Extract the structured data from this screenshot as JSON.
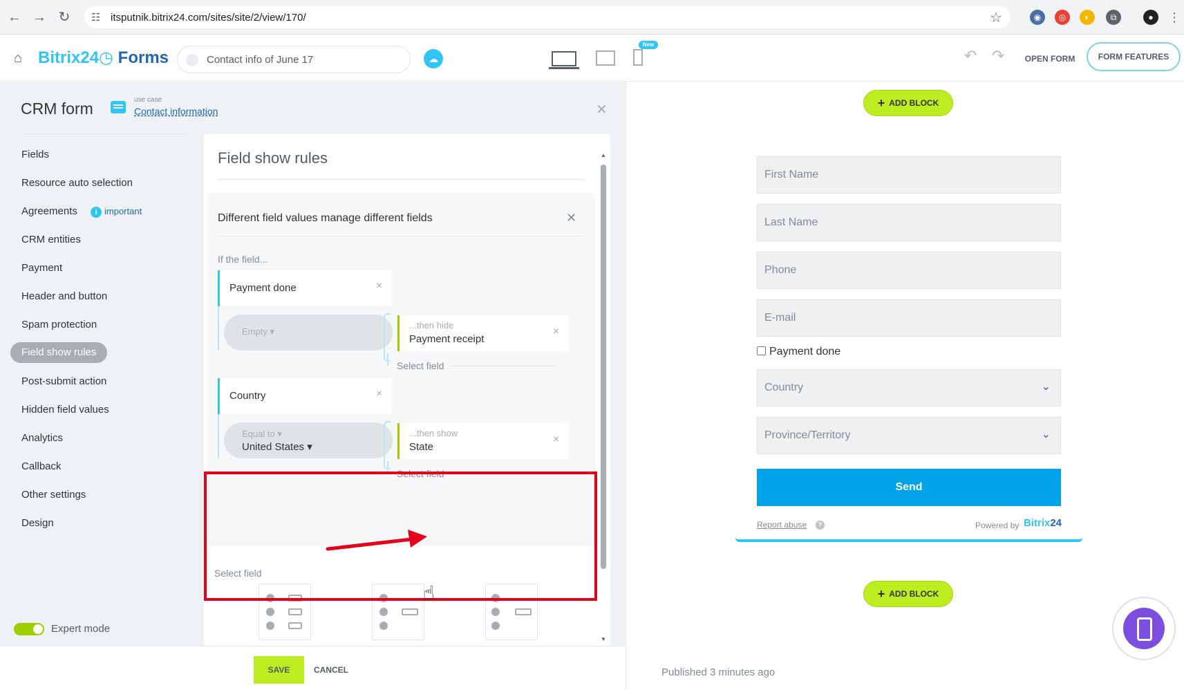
{
  "browser": {
    "url": "itsputnik.bitrix24.com/sites/site/2/view/170/"
  },
  "header": {
    "brand_name": "Bitrix24",
    "brand_product": "Forms",
    "form_title": "Contact info of June 17",
    "new_badge": "New",
    "open_form_label": "OPEN FORM",
    "form_features_label": "FORM FEATURES"
  },
  "sidebar": {
    "title": "CRM form",
    "use_case_label": "use case",
    "use_case_value": "Contact information",
    "items": [
      {
        "label": "Fields"
      },
      {
        "label": "Resource auto selection"
      },
      {
        "label": "Agreements",
        "badge": "important"
      },
      {
        "label": "CRM entities"
      },
      {
        "label": "Payment"
      },
      {
        "label": "Header and button"
      },
      {
        "label": "Spam protection"
      },
      {
        "label": "Field show rules",
        "active": true
      },
      {
        "label": "Post-submit action"
      },
      {
        "label": "Hidden field values"
      },
      {
        "label": "Analytics"
      },
      {
        "label": "Callback"
      },
      {
        "label": "Other settings"
      },
      {
        "label": "Design"
      }
    ],
    "expert_mode_label": "Expert mode"
  },
  "rules": {
    "title": "Field show rules",
    "block_title": "Different field values manage different fields",
    "if_label": "If the field...",
    "rule1": {
      "field": "Payment done",
      "value_op": "Empty",
      "action": "...then hide",
      "target": "Payment receipt",
      "select_field": "Select field"
    },
    "rule2": {
      "field": "Country",
      "value_op": "Equal to",
      "value": "United States",
      "action": "...then show",
      "target": "State",
      "select_field": "Select field"
    },
    "outer_select_field": "Select field"
  },
  "footer": {
    "save_label": "SAVE",
    "cancel_label": "CANCEL"
  },
  "preview": {
    "add_block_label": "ADD BLOCK",
    "fields": {
      "first_name": "First Name",
      "last_name": "Last Name",
      "phone": "Phone",
      "email": "E-mail",
      "payment_done": "Payment done",
      "country": "Country",
      "province": "Province/Territory"
    },
    "send_label": "Send",
    "report_abuse": "Report abuse",
    "powered_by": "Powered by",
    "powered_brand": "Bitrix",
    "powered_num": "24",
    "published": "Published 3 minutes ago"
  },
  "colors": {
    "accent_blue": "#2fc6f6",
    "brand_dark_blue": "#2067b0",
    "accent_green": "#bbed21",
    "send_blue": "#00a2e8",
    "highlight_red": "#e5001b"
  }
}
